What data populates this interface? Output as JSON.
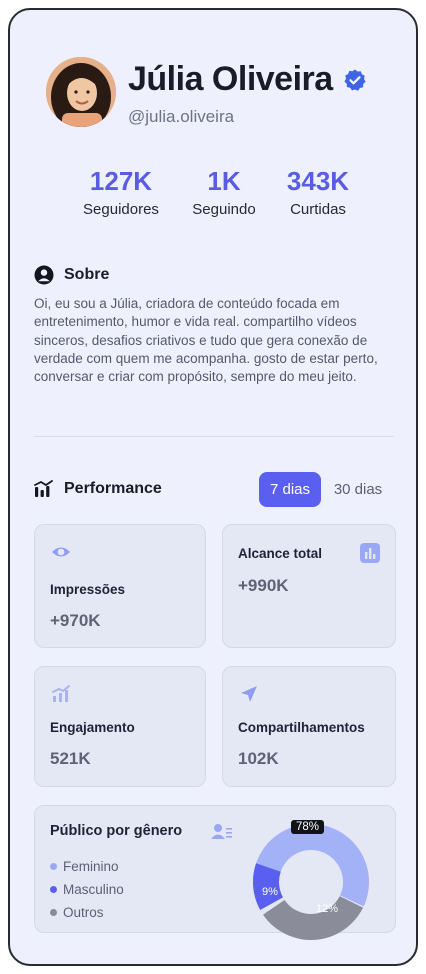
{
  "profile": {
    "name": "Júlia Oliveira",
    "handle": "@julia.oliveira"
  },
  "stats": [
    {
      "value": "127K",
      "label": "Seguidores"
    },
    {
      "value": "1K",
      "label": "Seguindo"
    },
    {
      "value": "343K",
      "label": "Curtidas"
    }
  ],
  "about": {
    "title": "Sobre",
    "text": "Oi, eu sou a Júlia, criadora de conteúdo focada em entretenimento, humor e vida real. compartilho vídeos sinceros, desafios criativos e tudo que gera conexão de verdade com quem me acompanha. gosto de estar perto, conversar e criar com propósito, sempre do meu jeito."
  },
  "performance": {
    "title": "Performance",
    "ranges": [
      "7 dias",
      "30 dias"
    ],
    "selected_range": "7 dias",
    "metrics": [
      {
        "label": "Impressões",
        "value": "+970K",
        "icon": "eye-icon"
      },
      {
        "label": "Alcance total",
        "value": "+990K",
        "icon": "bar-chart-icon"
      },
      {
        "label": "Engajamento",
        "value": "521K",
        "icon": "trend-bars-icon"
      },
      {
        "label": "Compartilhamentos",
        "value": "102K",
        "icon": "send-icon"
      }
    ]
  },
  "audience": {
    "title": "Público por gênero",
    "legend": [
      {
        "label": "Feminino",
        "color": "#9aa7f5"
      },
      {
        "label": "Masculino",
        "color": "#5b5ff0"
      },
      {
        "label": "Outros",
        "color": "#888a98"
      }
    ]
  },
  "chart_data": {
    "type": "pie",
    "labels": [
      "Feminino",
      "Masculino",
      "Outros"
    ],
    "values": [
      78,
      9,
      12
    ],
    "value_labels": [
      "78%",
      "9%",
      "12%"
    ],
    "colors": [
      "#a3b1f7",
      "#5b5ff0",
      "#8a8c99"
    ]
  }
}
